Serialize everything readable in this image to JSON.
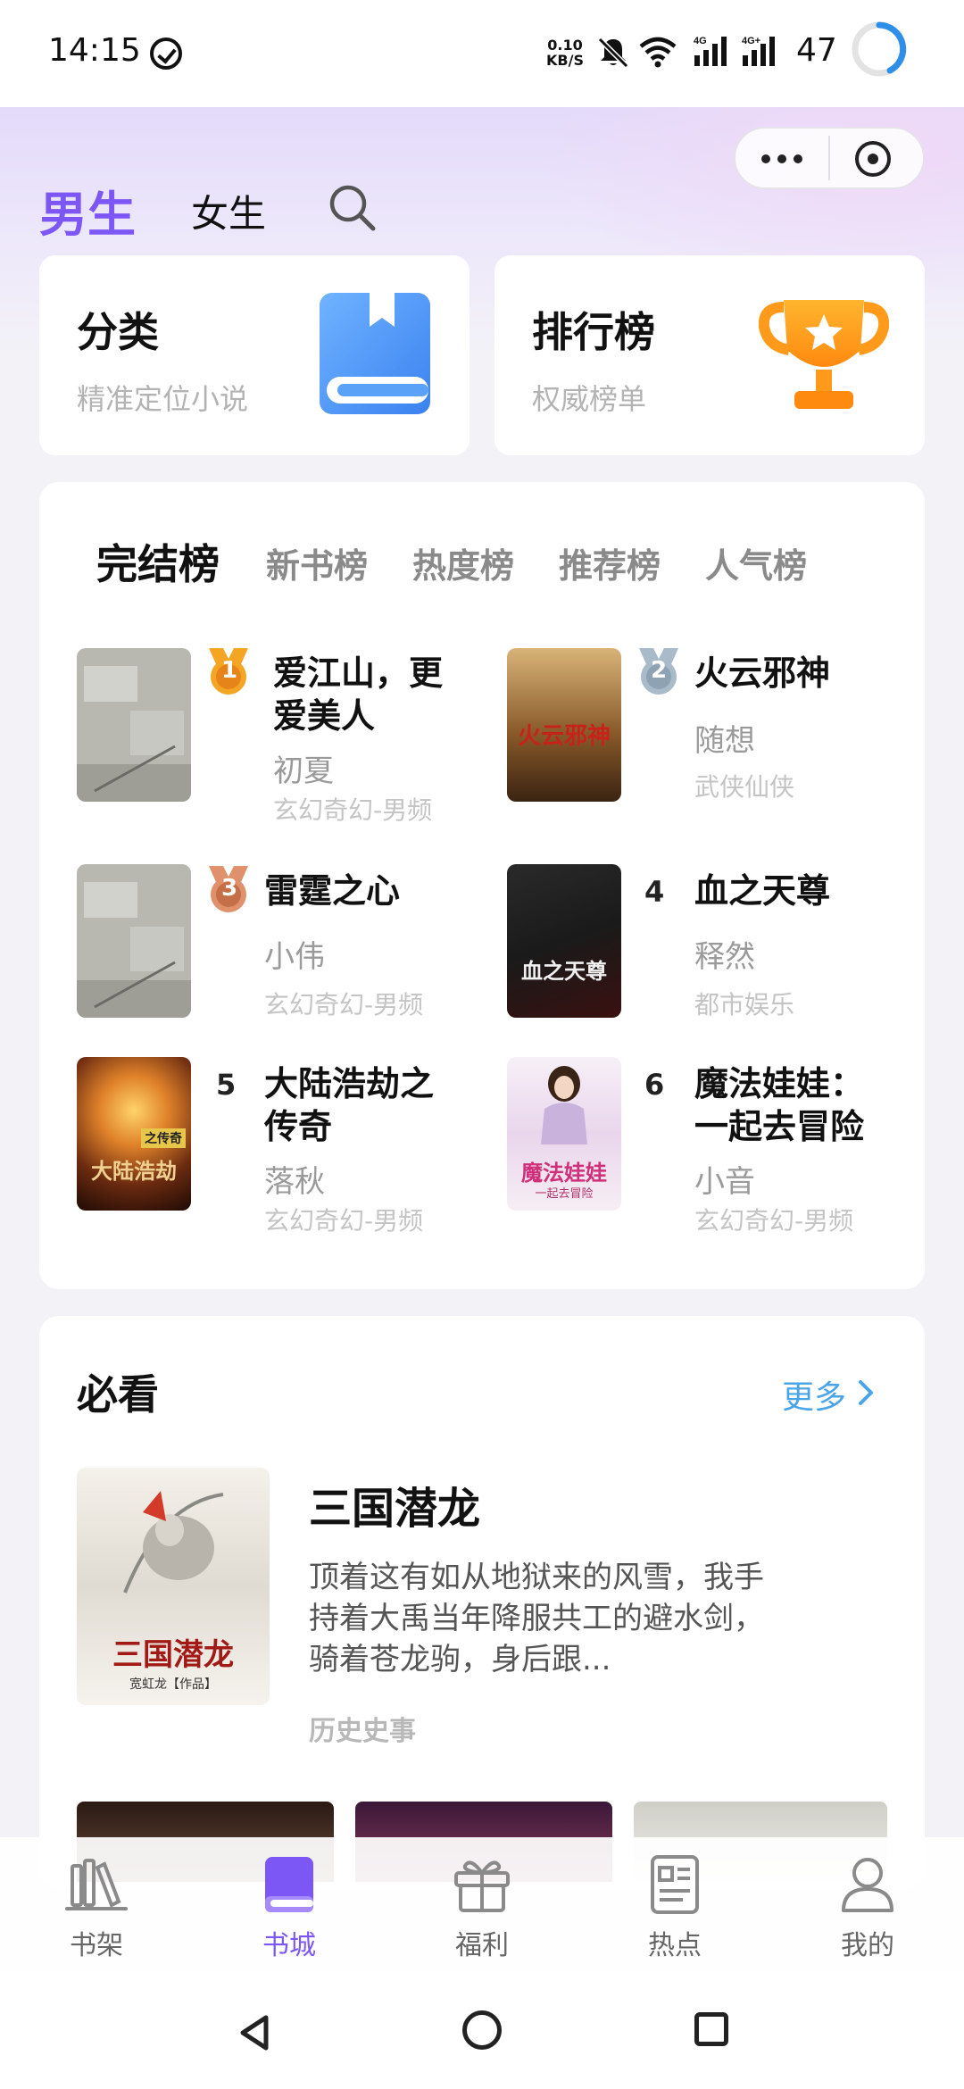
{
  "status_bar": {
    "time": "14:15",
    "net_speed_value": "0.10",
    "net_speed_unit": "KB/S",
    "signal1_label": "4G",
    "signal2_label": "4G+",
    "battery": "47"
  },
  "header": {
    "tabs": [
      {
        "label": "男生",
        "active": true
      },
      {
        "label": "女生",
        "active": false
      }
    ],
    "accent_color": "#7d57f6"
  },
  "quick_cards": [
    {
      "title": "分类",
      "subtitle": "精准定位小说",
      "icon": "book-icon"
    },
    {
      "title": "排行榜",
      "subtitle": "权威榜单",
      "icon": "trophy-icon"
    }
  ],
  "ranking": {
    "tabs": [
      "完结榜",
      "新书榜",
      "热度榜",
      "推荐榜",
      "人气榜"
    ],
    "active_tab": "完结榜",
    "books": [
      {
        "rank": "1",
        "title": "爱江山，更爱美人",
        "author": "初夏",
        "genre": "玄幻奇幻-男频",
        "medal": "gold"
      },
      {
        "rank": "2",
        "title": "火云邪神",
        "author": "随想",
        "genre": "武侠仙侠",
        "medal": "silver",
        "cover_text": "火云邪神"
      },
      {
        "rank": "3",
        "title": "雷霆之心",
        "author": "小伟",
        "genre": "玄幻奇幻-男频",
        "medal": "bronze"
      },
      {
        "rank": "4",
        "title": "血之天尊",
        "author": "释然",
        "genre": "都市娱乐",
        "cover_text": "血之天尊"
      },
      {
        "rank": "5",
        "title": "大陆浩劫之传奇",
        "author": "落秋",
        "genre": "玄幻奇幻-男频",
        "cover_text": "大陆浩劫",
        "cover_tag": "之传奇"
      },
      {
        "rank": "6",
        "title": "魔法娃娃：一起去冒险",
        "author": "小音",
        "genre": "玄幻奇幻-男频",
        "cover_text": "魔法娃娃",
        "cover_tag": "一起去冒险"
      }
    ]
  },
  "must_read": {
    "title": "必看",
    "more_label": "更多",
    "featured": {
      "title": "三国潜龙",
      "description": "顶着这有如从地狱来的风雪，我手持着大禹当年降服共工的避水剑，骑着苍龙驹，身后跟...",
      "genre": "历史史事",
      "cover_text": "三国潜龙",
      "cover_author": "宽虹龙【作品】"
    }
  },
  "bottom_nav": [
    {
      "label": "书架",
      "icon": "bookshelf-icon"
    },
    {
      "label": "书城",
      "icon": "bookstore-icon",
      "active": true
    },
    {
      "label": "福利",
      "icon": "gift-icon"
    },
    {
      "label": "热点",
      "icon": "news-icon"
    },
    {
      "label": "我的",
      "icon": "user-icon"
    }
  ]
}
